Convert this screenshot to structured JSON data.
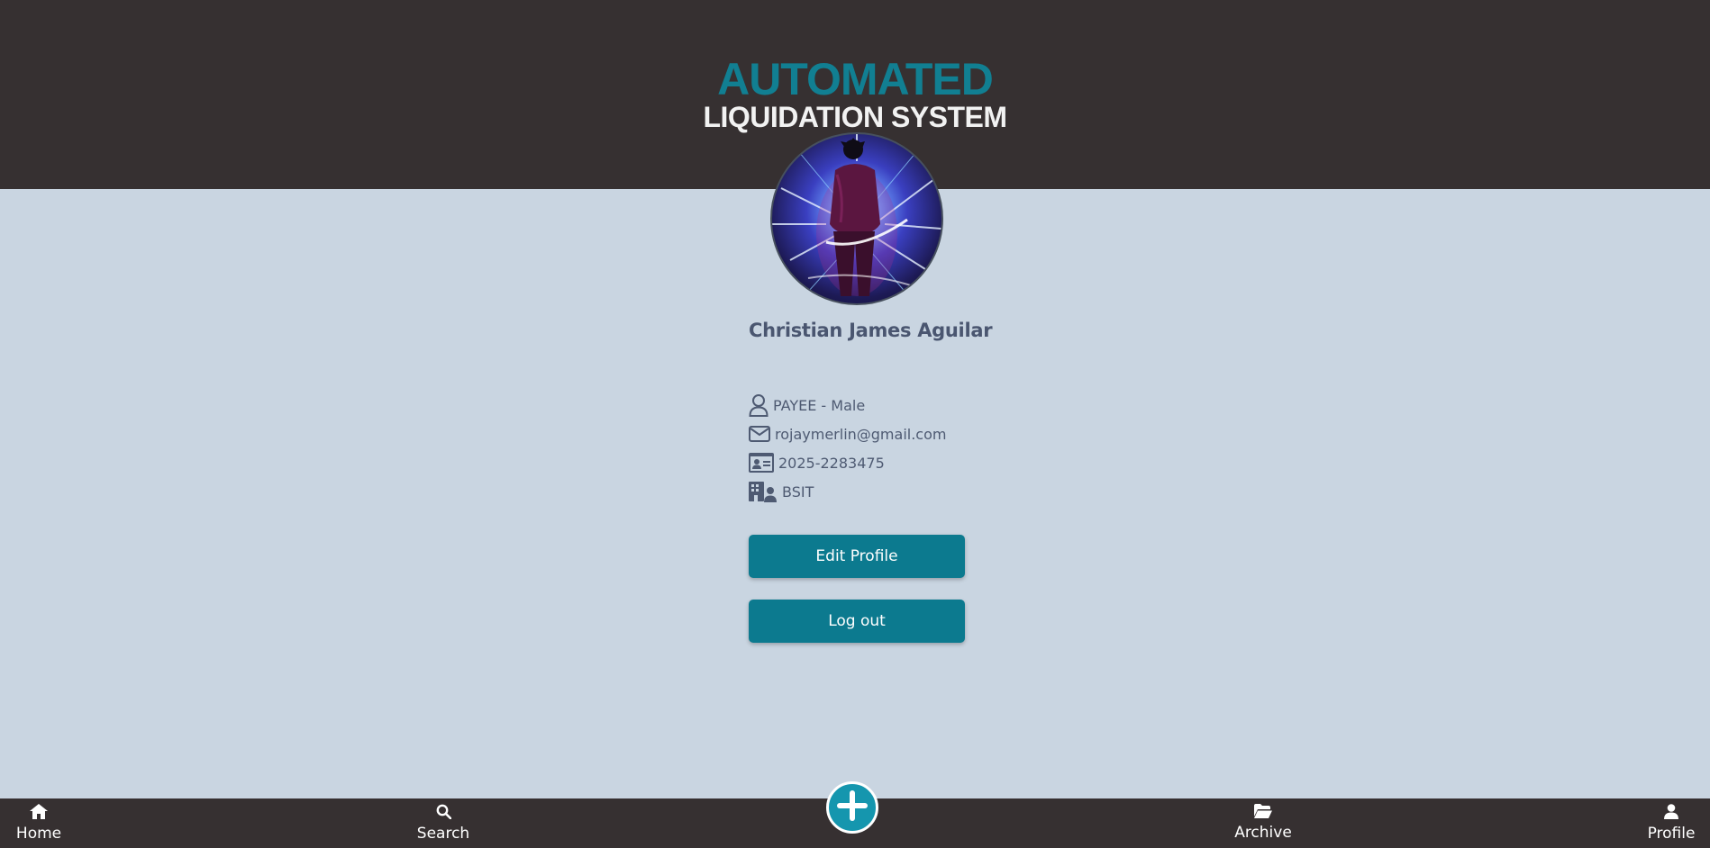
{
  "header": {
    "title_line1": "AUTOMATED",
    "title_line2": "LIQUIDATION SYSTEM"
  },
  "profile": {
    "name": "Christian James Aguilar",
    "role_gender": "PAYEE - Male",
    "email": "rojaymerlin@gmail.com",
    "id_number": "2025-2283475",
    "program": "BSIT",
    "avatar_icon": "avatar-photo"
  },
  "buttons": {
    "edit_profile": "Edit Profile",
    "log_out": "Log out"
  },
  "nav": {
    "items": [
      {
        "label": "Home",
        "icon": "home-icon"
      },
      {
        "label": "Search",
        "icon": "search-icon"
      },
      {
        "label": "Archive",
        "icon": "folder-open-icon"
      },
      {
        "label": "Profile",
        "icon": "user-icon"
      }
    ],
    "fab_icon": "plus-icon"
  },
  "colors": {
    "header_bg": "#363031",
    "page_bg": "#c9d5e1",
    "accent": "#117f92",
    "button": "#0c7a8f",
    "fab": "#1596ae",
    "text": "#4a5670"
  }
}
